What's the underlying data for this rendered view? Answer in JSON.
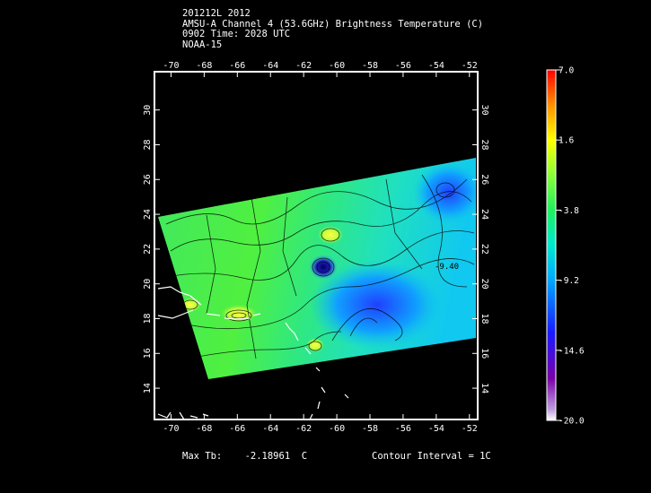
{
  "header": {
    "line1": "201212L 2012",
    "line2": "AMSU-A Channel 4 (53.6GHz) Brightness Temperature (C)",
    "line3": "0902 Time: 2028 UTC",
    "line4": "NOAA-15"
  },
  "map": {
    "lon_ticks": [
      "-70",
      "-68",
      "-66",
      "-64",
      "-62",
      "-60",
      "-58",
      "-56",
      "-54",
      "-52"
    ],
    "lat_ticks": [
      "14",
      "16",
      "18",
      "20",
      "22",
      "24",
      "26",
      "28",
      "30"
    ],
    "lon_range": [
      -71,
      -51.5
    ],
    "lat_range": [
      12.2,
      32.2
    ],
    "contour_label": "-9.40",
    "colormap": [
      "#ffffff",
      "#7a00a8",
      "#1a1aff",
      "#00c0ff",
      "#00e8a0",
      "#40f040",
      "#a0ff40",
      "#ffff00",
      "#ffa000",
      "#ff0000"
    ]
  },
  "colorbar": {
    "labels": [
      "7.0",
      "1.6",
      "-3.8",
      "-9.2",
      "-14.6",
      "-20.0"
    ],
    "min": -20.0,
    "max": 7.0
  },
  "footer": {
    "max_tb_label": "Max Tb:",
    "max_tb_value": "-2.18961",
    "max_tb_unit": "C",
    "contour_interval": "Contour Interval = 1C"
  }
}
